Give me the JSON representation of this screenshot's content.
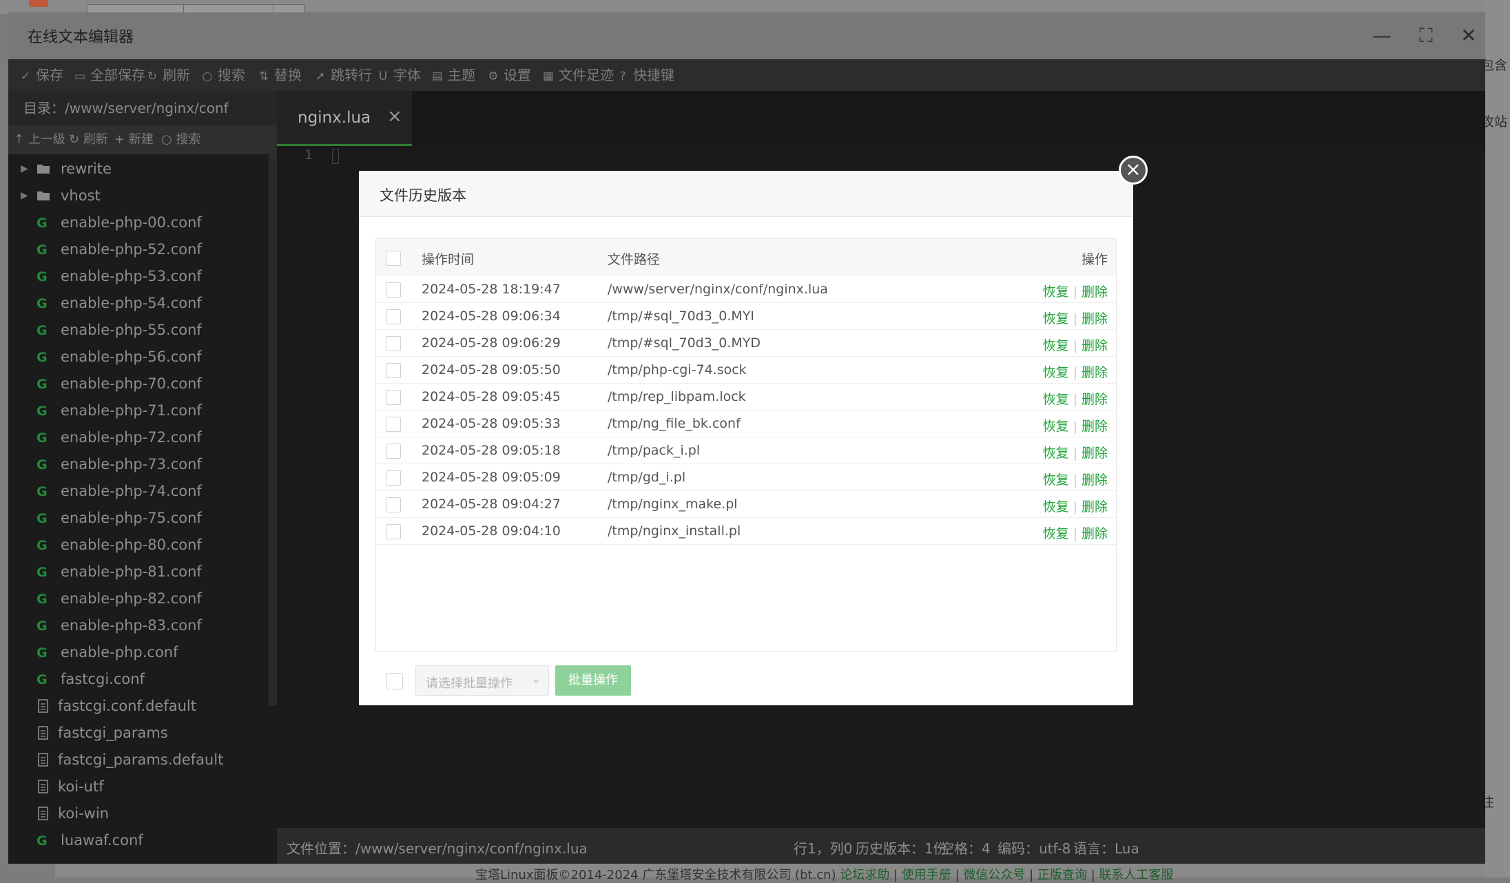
{
  "editor": {
    "title": "在线文本编辑器",
    "toolbar": [
      {
        "icon": "save-icon",
        "glyph": "✓",
        "label": "保存"
      },
      {
        "icon": "save-all-icon",
        "glyph": "▭",
        "label": "全部保存"
      },
      {
        "icon": "refresh-icon",
        "glyph": "↻",
        "label": "刷新"
      },
      {
        "icon": "search-icon",
        "glyph": "○",
        "label": "搜索"
      },
      {
        "icon": "replace-icon",
        "glyph": "⇅",
        "label": "替换"
      },
      {
        "icon": "goto-line-icon",
        "glyph": "➚",
        "label": "跳转行"
      },
      {
        "icon": "font-icon",
        "glyph": "U",
        "label": "字体"
      },
      {
        "icon": "theme-icon",
        "glyph": "▤",
        "label": "主题"
      },
      {
        "icon": "settings-icon",
        "glyph": "⚙",
        "label": "设置"
      },
      {
        "icon": "file-history-icon",
        "glyph": "▦",
        "label": "文件足迹"
      },
      {
        "icon": "help-icon",
        "glyph": "?",
        "label": "快捷键"
      }
    ],
    "sidebar": {
      "dir_label": "目录：/www/server/nginx/conf",
      "actions": [
        {
          "icon": "up-arrow-icon",
          "glyph": "↑",
          "label": "上一级"
        },
        {
          "icon": "refresh-icon",
          "glyph": "↻",
          "label": "刷新"
        },
        {
          "icon": "plus-icon",
          "glyph": "+",
          "label": "新建"
        },
        {
          "icon": "search-icon",
          "glyph": "○",
          "label": "搜索"
        }
      ],
      "tree": [
        {
          "type": "folder",
          "name": "rewrite"
        },
        {
          "type": "folder",
          "name": "vhost"
        },
        {
          "type": "conf",
          "name": "enable-php-00.conf"
        },
        {
          "type": "conf",
          "name": "enable-php-52.conf"
        },
        {
          "type": "conf",
          "name": "enable-php-53.conf"
        },
        {
          "type": "conf",
          "name": "enable-php-54.conf"
        },
        {
          "type": "conf",
          "name": "enable-php-55.conf"
        },
        {
          "type": "conf",
          "name": "enable-php-56.conf"
        },
        {
          "type": "conf",
          "name": "enable-php-70.conf"
        },
        {
          "type": "conf",
          "name": "enable-php-71.conf"
        },
        {
          "type": "conf",
          "name": "enable-php-72.conf"
        },
        {
          "type": "conf",
          "name": "enable-php-73.conf"
        },
        {
          "type": "conf",
          "name": "enable-php-74.conf"
        },
        {
          "type": "conf",
          "name": "enable-php-75.conf"
        },
        {
          "type": "conf",
          "name": "enable-php-80.conf"
        },
        {
          "type": "conf",
          "name": "enable-php-81.conf"
        },
        {
          "type": "conf",
          "name": "enable-php-82.conf"
        },
        {
          "type": "conf",
          "name": "enable-php-83.conf"
        },
        {
          "type": "conf",
          "name": "enable-php.conf"
        },
        {
          "type": "conf",
          "name": "fastcgi.conf"
        },
        {
          "type": "text",
          "name": "fastcgi.conf.default"
        },
        {
          "type": "text",
          "name": "fastcgi_params"
        },
        {
          "type": "text",
          "name": "fastcgi_params.default"
        },
        {
          "type": "text",
          "name": "koi-utf"
        },
        {
          "type": "text",
          "name": "koi-win"
        },
        {
          "type": "conf",
          "name": "luawaf.conf"
        }
      ]
    },
    "tab": {
      "label": "nginx.lua",
      "close": "×"
    },
    "gutter_line": "1",
    "statusbar": {
      "location": "文件位置：/www/server/nginx/conf/nginx.lua",
      "cursor": "行1，列0",
      "history": "历史版本：1份",
      "spaces": "空格：4",
      "encoding": "编码：utf-8",
      "language": "语言：Lua"
    }
  },
  "modal": {
    "title": "文件历史版本",
    "columns": {
      "time": "操作时间",
      "path": "文件路径",
      "op": "操作"
    },
    "actions": {
      "restore": "恢复",
      "delete": "删除"
    },
    "rows": [
      {
        "time": "2024-05-28 18:19:47",
        "path": "/www/server/nginx/conf/nginx.lua"
      },
      {
        "time": "2024-05-28 09:06:34",
        "path": "/tmp/#sql_70d3_0.MYI"
      },
      {
        "time": "2024-05-28 09:06:29",
        "path": "/tmp/#sql_70d3_0.MYD"
      },
      {
        "time": "2024-05-28 09:05:50",
        "path": "/tmp/php-cgi-74.sock"
      },
      {
        "time": "2024-05-28 09:05:45",
        "path": "/tmp/rep_libpam.lock"
      },
      {
        "time": "2024-05-28 09:05:33",
        "path": "/tmp/ng_file_bk.conf"
      },
      {
        "time": "2024-05-28 09:05:18",
        "path": "/tmp/pack_i.pl"
      },
      {
        "time": "2024-05-28 09:05:09",
        "path": "/tmp/gd_i.pl"
      },
      {
        "time": "2024-05-28 09:04:27",
        "path": "/tmp/nginx_make.pl"
      },
      {
        "time": "2024-05-28 09:04:10",
        "path": "/tmp/nginx_install.pl"
      }
    ],
    "batch_placeholder": "请选择批量操作",
    "batch_button": "批量操作"
  },
  "background": {
    "right_texts": [
      "包含",
      "攻站",
      "往"
    ],
    "footer_text": "宝塔Linux面板©2014-2024 广东堡塔安全技术有限公司 (bt.cn)",
    "footer_links": [
      "论坛求助",
      "使用手册",
      "微信公众号",
      "正版查询",
      "联系人工客服"
    ]
  },
  "colors": {
    "accent": "#20a53a",
    "batch_button": "#8fd19b"
  }
}
